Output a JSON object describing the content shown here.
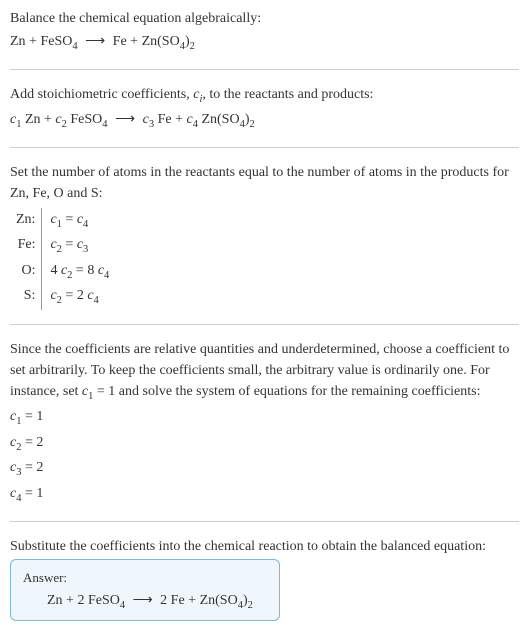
{
  "intro": {
    "title": "Balance the chemical equation algebraically:",
    "prefix1": "Zn + FeSO",
    "sub1": "4",
    "arrow": "⟶",
    "mid1": "Fe + Zn(SO",
    "sub2": "4",
    "suffix1": ")",
    "sub3": "2"
  },
  "section2": {
    "text_a": "Add stoichiometric coefficients, ",
    "ci_c": "c",
    "ci_i": "i",
    "text_b": ", to the reactants and products:",
    "c1": "c",
    "n1": "1",
    "sp1": " Zn + ",
    "c2": "c",
    "n2": "2",
    "sp2": " FeSO",
    "sub4": "4",
    "arrow": "⟶",
    "c3": "c",
    "n3": "3",
    "sp3": " Fe + ",
    "c4": "c",
    "n4": "4",
    "sp4": " Zn(SO",
    "sub5": "4",
    "sp5": ")",
    "sub6": "2"
  },
  "section3": {
    "text": "Set the number of atoms in the reactants equal to the number of atoms in the products for Zn, Fe, O and S:",
    "rows": [
      {
        "el": "Zn:",
        "lhs_c": "c",
        "lhs_n": "1",
        "eq": " = ",
        "rhs_c": "c",
        "rhs_n": "4",
        "lhs_pre": "",
        "rhs_pre": ""
      },
      {
        "el": "Fe:",
        "lhs_c": "c",
        "lhs_n": "2",
        "eq": " = ",
        "rhs_c": "c",
        "rhs_n": "3",
        "lhs_pre": "",
        "rhs_pre": ""
      },
      {
        "el": "O:",
        "lhs_c": "c",
        "lhs_n": "2",
        "eq": " = ",
        "rhs_c": "c",
        "rhs_n": "4",
        "lhs_pre": "4 ",
        "rhs_pre": "8 "
      },
      {
        "el": "S:",
        "lhs_c": "c",
        "lhs_n": "2",
        "eq": " = ",
        "rhs_c": "c",
        "rhs_n": "4",
        "lhs_pre": "",
        "rhs_pre": "2 "
      }
    ]
  },
  "section4": {
    "text_a": "Since the coefficients are relative quantities and underdetermined, choose a coefficient to set arbitrarily. To keep the coefficients small, the arbitrary value is ordinarily one. For instance, set ",
    "c1c": "c",
    "c1n": "1",
    "text_b": " = 1 and solve the system of equations for the remaining coefficients:",
    "solutions": [
      {
        "c": "c",
        "n": "1",
        "eq": " = 1"
      },
      {
        "c": "c",
        "n": "2",
        "eq": " = 2"
      },
      {
        "c": "c",
        "n": "3",
        "eq": " = 2"
      },
      {
        "c": "c",
        "n": "4",
        "eq": " = 1"
      }
    ]
  },
  "section5": {
    "text": "Substitute the coefficients into the chemical reaction to obtain the balanced equation:",
    "answer_label": "Answer:",
    "eqn_a": "Zn + 2 FeSO",
    "sub1": "4",
    "arrow": "⟶",
    "eqn_b": "2 Fe + Zn(SO",
    "sub2": "4",
    "eqn_c": ")",
    "sub3": "2"
  }
}
